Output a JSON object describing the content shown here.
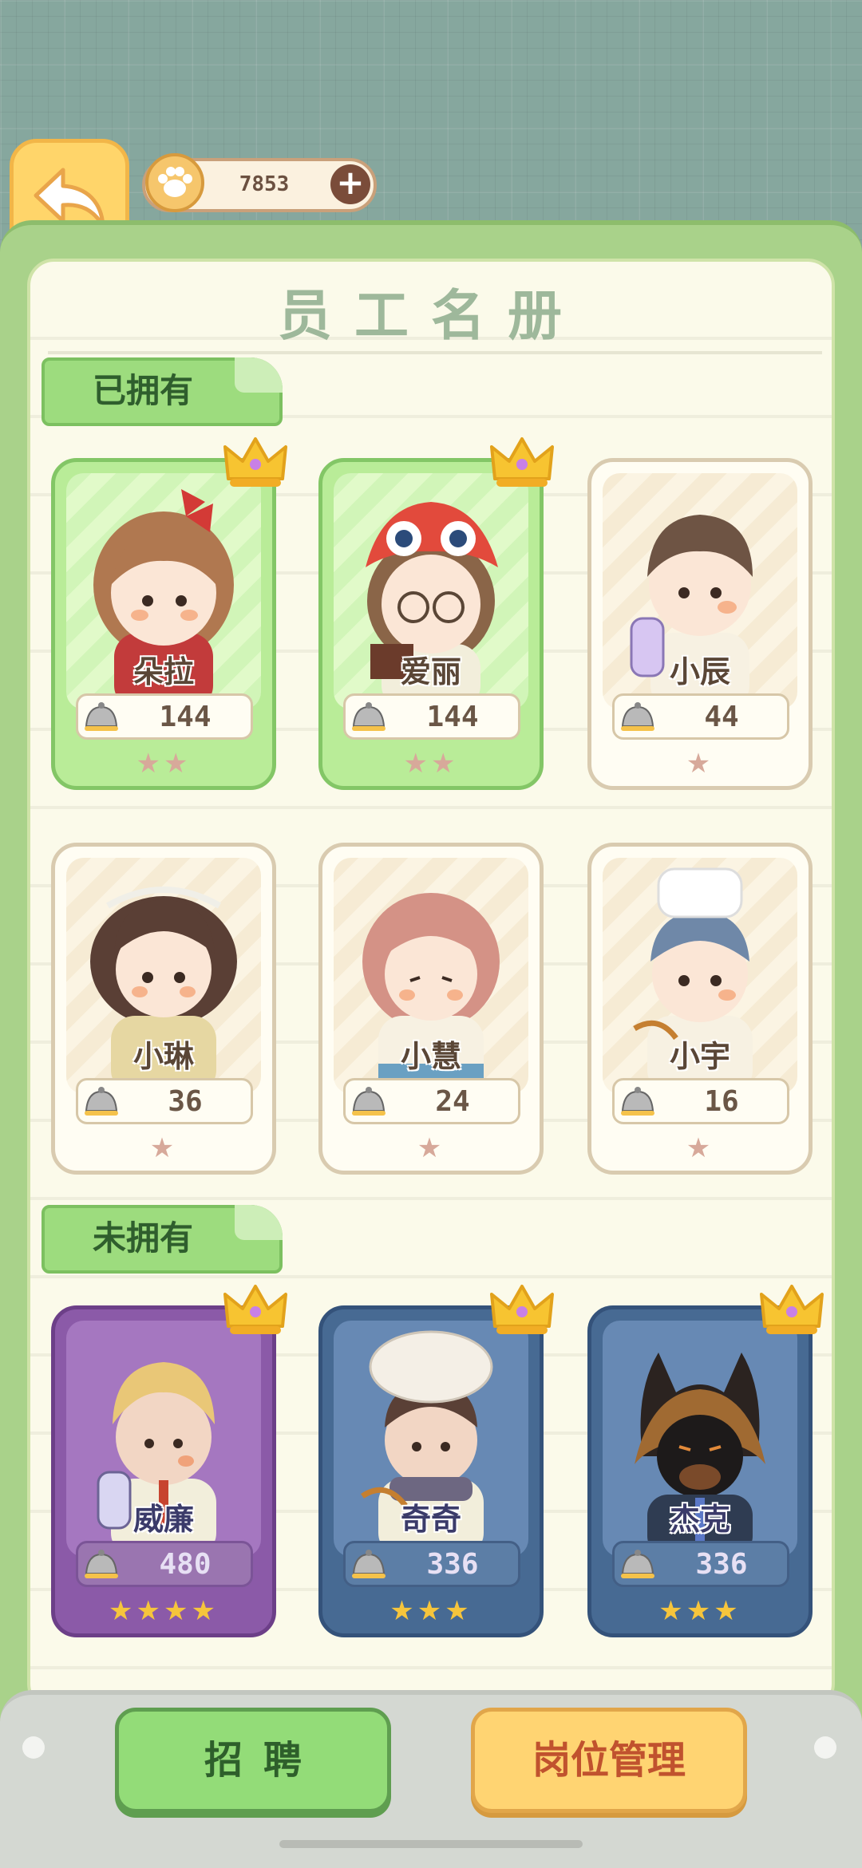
{
  "header": {
    "currency_value": "7853",
    "plus_label": "+"
  },
  "title": "员工名册",
  "sections": {
    "owned": "已拥有",
    "not_owned": "未拥有"
  },
  "owned": [
    {
      "name": "朵拉",
      "value": "144",
      "stars": "★★"
    },
    {
      "name": "爱丽",
      "value": "144",
      "stars": "★★"
    },
    {
      "name": "小辰",
      "value": "44",
      "stars": "★"
    },
    {
      "name": "小琳",
      "value": "36",
      "stars": "★"
    },
    {
      "name": "小慧",
      "value": "24",
      "stars": "★"
    },
    {
      "name": "小宇",
      "value": "16",
      "stars": "★"
    }
  ],
  "not_owned": [
    {
      "name": "威廉",
      "value": "480",
      "stars": "★★★★"
    },
    {
      "name": "奇奇",
      "value": "336",
      "stars": "★★★"
    },
    {
      "name": "杰克",
      "value": "336",
      "stars": "★★★"
    }
  ],
  "buttons": {
    "recruit": "招聘",
    "manage": "岗位管理"
  },
  "colors": {
    "owned_highlight": "#b9ec98",
    "legendary": "#8b5aa8",
    "epic": "#476a93",
    "gold_button": "#ffd472",
    "green_button": "#93dc78"
  }
}
